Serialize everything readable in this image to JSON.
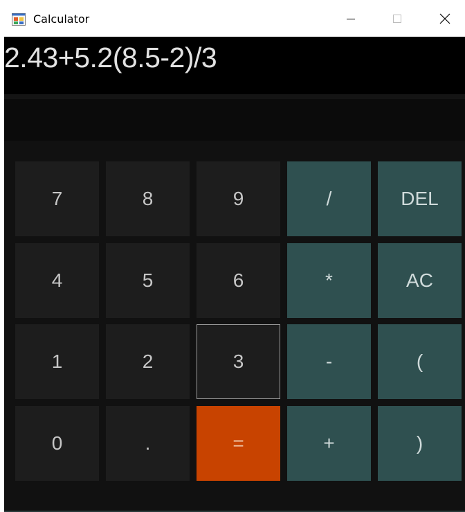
{
  "window": {
    "title": "Calculator",
    "app_icon": "calculator-app-icon",
    "controls": {
      "minimize_icon": "minimize-icon",
      "maximize_icon": "maximize-icon",
      "close_icon": "close-icon"
    }
  },
  "display": {
    "expression": "2.43+5.2(8.5-2)/3",
    "result": ""
  },
  "keypad": {
    "rows": [
      [
        {
          "label": "7",
          "kind": "num"
        },
        {
          "label": "8",
          "kind": "num"
        },
        {
          "label": "9",
          "kind": "num"
        },
        {
          "label": "/",
          "kind": "op"
        },
        {
          "label": "DEL",
          "kind": "op"
        }
      ],
      [
        {
          "label": "4",
          "kind": "num"
        },
        {
          "label": "5",
          "kind": "num"
        },
        {
          "label": "6",
          "kind": "num"
        },
        {
          "label": "*",
          "kind": "op"
        },
        {
          "label": "AC",
          "kind": "op"
        }
      ],
      [
        {
          "label": "1",
          "kind": "num"
        },
        {
          "label": "2",
          "kind": "num"
        },
        {
          "label": "3",
          "kind": "num",
          "focused": true
        },
        {
          "label": "-",
          "kind": "op"
        },
        {
          "label": "(",
          "kind": "op"
        }
      ],
      [
        {
          "label": "0",
          "kind": "num"
        },
        {
          "label": ".",
          "kind": "num"
        },
        {
          "label": "=",
          "kind": "eq"
        },
        {
          "label": "+",
          "kind": "op"
        },
        {
          "label": ")",
          "kind": "op"
        }
      ]
    ]
  },
  "colors": {
    "number_key": "#1d1d1d",
    "operator_key": "#2f5050",
    "equals_key": "#c84300",
    "display_background": "#000000",
    "key_text": "#c6c6c6"
  }
}
